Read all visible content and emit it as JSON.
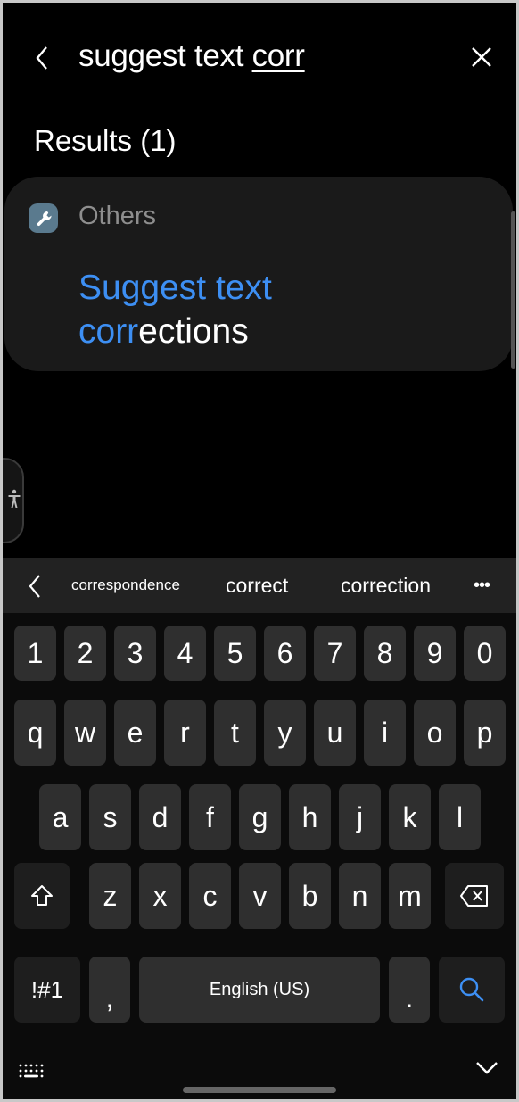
{
  "header": {
    "back_icon": "chevron-left-icon",
    "query_prefix": "suggest text ",
    "query_composing": "corr",
    "clear_icon": "close-icon"
  },
  "results": {
    "title": "Results (1)",
    "groups": [
      {
        "category": "Others",
        "category_icon": "wrench-icon",
        "items": [
          {
            "title_match_1": "Suggest text",
            "title_match_2": "corr",
            "title_rest": "ections"
          }
        ]
      }
    ]
  },
  "accessibility_button": {
    "icon": "accessibility-icon"
  },
  "keyboard": {
    "suggestions": [
      "correspondence",
      "correct",
      "correction"
    ],
    "more_icon": "more-horizontal-icon",
    "more_label": "•••",
    "rows": {
      "numbers": [
        "1",
        "2",
        "3",
        "4",
        "5",
        "6",
        "7",
        "8",
        "9",
        "0"
      ],
      "row1": [
        "q",
        "w",
        "e",
        "r",
        "t",
        "y",
        "u",
        "i",
        "o",
        "p"
      ],
      "row2": [
        "a",
        "s",
        "d",
        "f",
        "g",
        "h",
        "j",
        "k",
        "l"
      ],
      "row3": [
        "z",
        "x",
        "c",
        "v",
        "b",
        "n",
        "m"
      ]
    },
    "symbols_label": "!#1",
    "comma_label": ",",
    "space_label": "English (US)",
    "period_label": ".",
    "shift_icon": "shift-icon",
    "backspace_icon": "backspace-icon",
    "search_icon": "search-icon",
    "keyboard_switch_icon": "keyboard-icon",
    "hide_keyboard_icon": "chevron-down-icon"
  },
  "colors": {
    "accent": "#3d8ff3",
    "background": "#000000",
    "card": "#1a1a1a",
    "key": "#2f2f2f",
    "category_icon_bg": "#5a7a8e"
  }
}
